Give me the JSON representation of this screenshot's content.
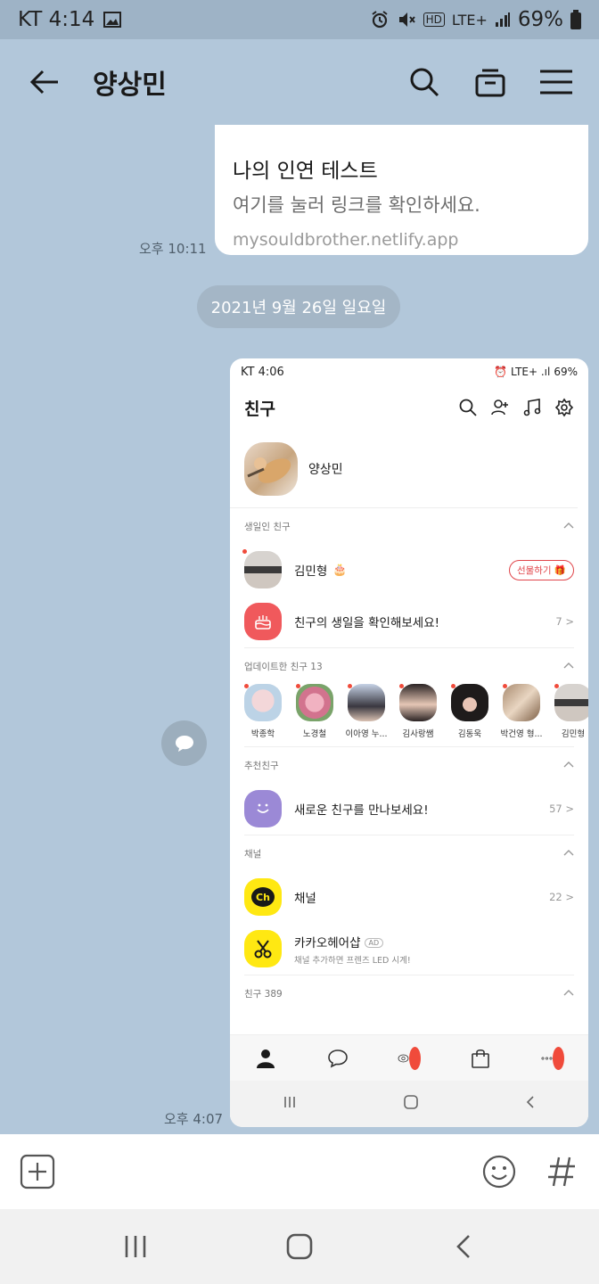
{
  "status_bar": {
    "carrier_time": "KT 4:14",
    "network": "LTE+",
    "battery": "69%"
  },
  "header": {
    "title": "양상민"
  },
  "messages": {
    "link_card": {
      "title": "나의 인연 테스트",
      "description": "여기를 눌러 링크를 확인하세요.",
      "url": "mysouldbrother.netlify.app"
    },
    "time_1": "오후 10:11",
    "date_divider": "2021년 9월 26일 일요일",
    "time_2": "오후 4:07"
  },
  "screenshot": {
    "status_time": "KT 4:06",
    "status_battery": "69%",
    "title": "친구",
    "my_name": "양상민",
    "birthday_header": "생일인 친구",
    "birthday_friend": "김민형",
    "gift_button": "선물하기",
    "birthday_check": "친구의 생일을 확인해보세요!",
    "birthday_count": "7 >",
    "updated_header": "업데이트한 친구 13",
    "updated_friends": [
      "박종학",
      "노경철",
      "이아영 누...",
      "김사랑쌤",
      "김동욱",
      "박건영 형...",
      "김민형"
    ],
    "recommend_header": "추천친구",
    "recommend_text": "새로운 친구를 만나보세요!",
    "recommend_count": "57 >",
    "channel_header": "채널",
    "channel_name": "채널",
    "channel_count": "22 >",
    "hairshop_name": "카카오헤어샵",
    "hairshop_ad": "AD",
    "hairshop_sub": "채널 추가하면 프렌즈 LED 시계!",
    "friends_header": "친구 389",
    "ch_icon_text": "Ch"
  },
  "colors": {
    "chat_bg": "#b2c7da",
    "accent_red": "#e0454a",
    "kakao_yellow": "#ffe812",
    "purple": "#9b89d6"
  }
}
